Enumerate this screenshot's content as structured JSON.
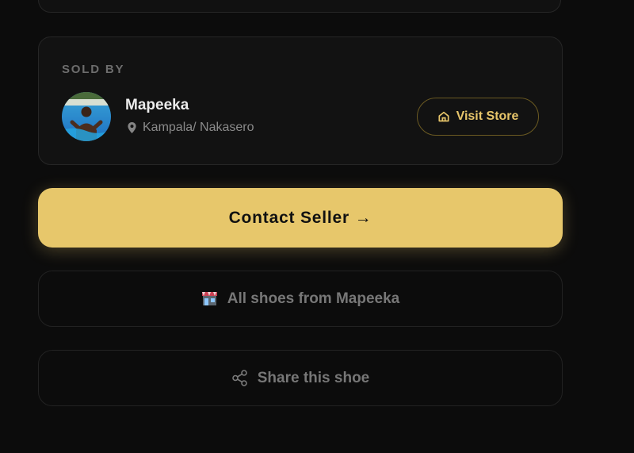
{
  "seller": {
    "section_label": "SOLD BY",
    "name": "Mapeeka",
    "location": "Kampala/ Nakasero",
    "visit_store_label": "Visit Store"
  },
  "actions": {
    "contact_label": "Contact Seller →",
    "all_shoes_label": "All shoes from Mapeeka",
    "share_label": "Share this shoe"
  },
  "icons": {
    "location": "map-pin-icon",
    "visit_store": "home-icon",
    "all_shoes": "store-icon",
    "share": "share-icon"
  },
  "colors": {
    "background": "#0c0c0c",
    "card": "#121212",
    "accent": "#e7c76b",
    "muted_text": "#777777"
  }
}
